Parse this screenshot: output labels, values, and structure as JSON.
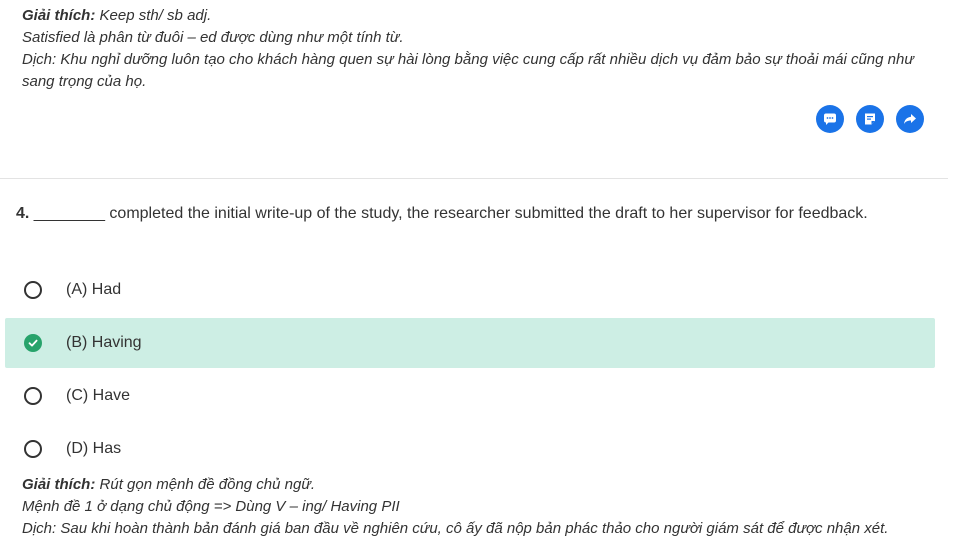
{
  "previous_explanation": {
    "label": "Giải thích:",
    "rule": "Keep sth/ sb adj.",
    "line2": "Satisfied là phân từ đuôi – ed được dùng như một tính từ.",
    "translation": "Dịch: Khu nghỉ dưỡng luôn tạo cho khách hàng quen sự hài lòng bằng việc cung cấp rất nhiều dịch vụ đảm bảo sự thoải mái cũng như sang trọng của họ."
  },
  "action_buttons": [
    {
      "icon": "comment-icon"
    },
    {
      "icon": "note-icon"
    },
    {
      "icon": "share-icon"
    }
  ],
  "question": {
    "number": "4.",
    "text": " ________ completed the initial write-up of the study, the researcher submitted the draft to her supervisor for feedback."
  },
  "options": [
    {
      "label": "(A) Had",
      "selected": false
    },
    {
      "label": "(B) Having",
      "selected": true
    },
    {
      "label": "(C) Have",
      "selected": false
    },
    {
      "label": "(D) Has",
      "selected": false
    }
  ],
  "current_explanation": {
    "label": "Giải thích:",
    "rule": "Rút gọn mệnh đề đồng chủ ngữ.",
    "line2": "Mệnh đề 1 ở dạng chủ động => Dùng V – ing/ Having PII",
    "translation": "Dịch: Sau khi hoàn thành bản đánh giá ban đầu về nghiên cứu, cô ấy đã nộp bản phác thảo cho người giám sát để được nhận xét."
  },
  "colors": {
    "accent": "#1a73e8",
    "selected_bg": "#cdeee4",
    "correct": "#27a36b"
  }
}
